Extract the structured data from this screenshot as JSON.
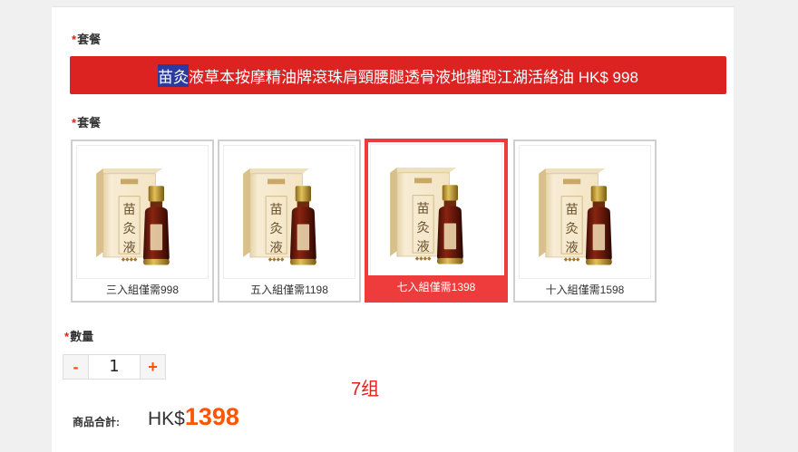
{
  "section1": {
    "star": "*",
    "label": "套餐"
  },
  "banner": {
    "highlight": "苗灸",
    "text": "液草本按摩精油牌滾珠肩頸腰腿透骨液地攤跑江湖活絡油 HK$ 998"
  },
  "section2": {
    "star": "*",
    "label": "套餐"
  },
  "options": [
    {
      "caption": "三入組僅需998",
      "selected": false
    },
    {
      "caption": "五入組僅需1198",
      "selected": false
    },
    {
      "caption": "七入組僅需1398",
      "selected": true
    },
    {
      "caption": "十入組僅需1598",
      "selected": false
    }
  ],
  "product_image": {
    "box_title": "苗灸液",
    "icon": "essential-oil-product-image"
  },
  "quantity": {
    "star": "*",
    "label": "數量",
    "minus": "-",
    "value": "1",
    "plus": "+"
  },
  "note": "7组",
  "total": {
    "label": "商品合計:",
    "currency": "HK$",
    "amount": "1398"
  },
  "colors": {
    "accent": "#dd2222",
    "selected_border": "#ee3b3b",
    "price": "#ff5500"
  }
}
